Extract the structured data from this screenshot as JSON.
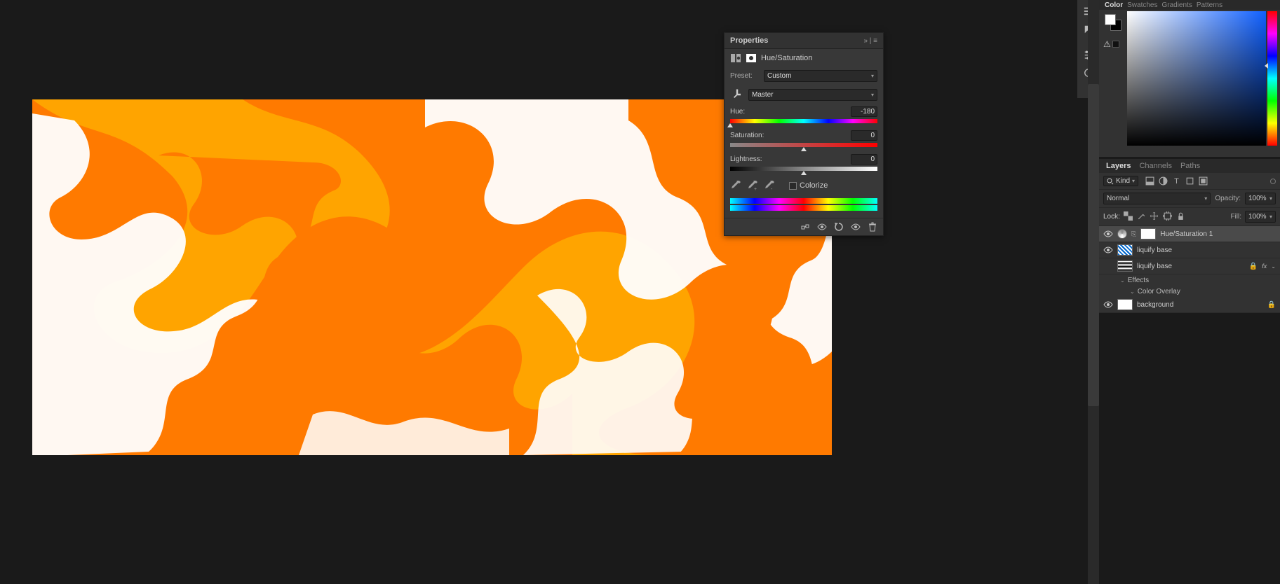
{
  "properties_panel": {
    "title": "Properties",
    "adjustment_type": "Hue/Saturation",
    "preset_label": "Preset:",
    "preset_value": "Custom",
    "channel_value": "Master",
    "hue_label": "Hue:",
    "hue_value": "-180",
    "saturation_label": "Saturation:",
    "saturation_value": "0",
    "lightness_label": "Lightness:",
    "lightness_value": "0",
    "colorize_label": "Colorize"
  },
  "color_panel": {
    "tabs": [
      "Color",
      "Swatches",
      "Gradients",
      "Patterns"
    ],
    "active_tab": "Color"
  },
  "layers_panel": {
    "tabs": [
      "Layers",
      "Channels",
      "Paths"
    ],
    "active_tab": "Layers",
    "filter_kind": "Kind",
    "blend_mode": "Normal",
    "opacity_label": "Opacity:",
    "opacity_value": "100%",
    "lock_label": "Lock:",
    "fill_label": "Fill:",
    "fill_value": "100%",
    "layers": [
      {
        "name": "Hue/Saturation 1",
        "type": "adjustment",
        "visible": true,
        "selected": true
      },
      {
        "name": "liquify base",
        "type": "pattern",
        "visible": true
      },
      {
        "name": "liquify base",
        "type": "noise",
        "visible": false,
        "fx": true,
        "locked": true,
        "effects_label": "Effects",
        "effects": [
          "Color Overlay"
        ]
      },
      {
        "name": "background",
        "type": "white",
        "visible": true,
        "locked": true
      }
    ]
  }
}
